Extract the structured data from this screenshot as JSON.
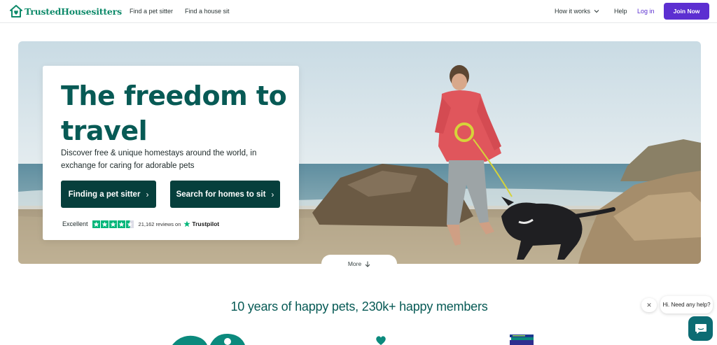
{
  "header": {
    "logo_text": "TrustedHousesitters",
    "nav_left": [
      "Find a pet sitter",
      "Find a house sit"
    ],
    "how_it_works": "How it works",
    "help": "Help",
    "login": "Log in",
    "join": "Join Now"
  },
  "hero": {
    "title": "The freedom to travel",
    "subtitle": "Discover free & unique homestays around the world, in exchange for caring for adorable pets",
    "cta_primary": "Finding a pet sitter",
    "cta_secondary": "Search for homes to sit",
    "trust_label": "Excellent",
    "trust_reviews": "21,162 reviews on",
    "trustpilot": "Trustpilot",
    "rating_stars": 4.5
  },
  "more_label": "More",
  "stats_heading": "10 years of happy pets, 230k+ happy members",
  "chat": {
    "greeting": "Hi. Need any help?"
  },
  "colors": {
    "brand_green": "#0e8a6a",
    "heading_teal": "#075a55",
    "cta_dark": "#063f3c",
    "join_purple": "#5c2fd1",
    "trustpilot_green": "#00b67a",
    "chat_teal": "#0c6c73"
  },
  "icons": [
    "house-heart-logo-icon",
    "chevron-down-icon",
    "chevron-right-icon",
    "arrow-down-icon",
    "trustpilot-star-icon",
    "close-icon",
    "chat-icon"
  ]
}
